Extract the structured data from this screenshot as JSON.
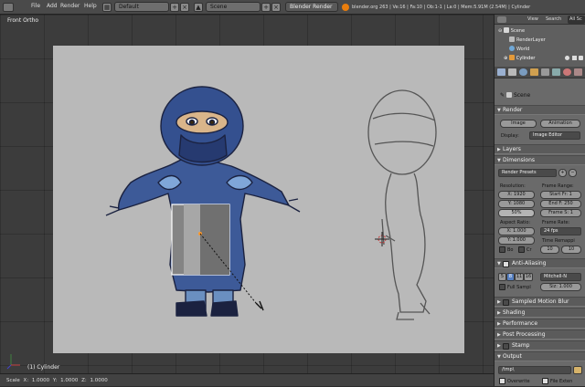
{
  "topbar": {
    "menus": [
      "File",
      "Add",
      "Render",
      "Help"
    ],
    "layout": "Default",
    "scene": "Scene",
    "engine": "Blender Render",
    "info": "blender.org 263 | Ve:16 | Fa:10 | Ob:1-1 | La:0 | Mem:5.91M (2.54M) | Cylinder"
  },
  "viewport": {
    "view_name": "Front Ortho",
    "object_label": "(1) Cylinder"
  },
  "statusbar": {
    "scale": "Scale X: 1.0000  Y: 1.0000  Z: 1.0000"
  },
  "outliner": {
    "view": "View",
    "search": "Search",
    "all": "All Sc",
    "items": [
      "Scene",
      "RenderLayer",
      "World",
      "Cylinder"
    ]
  },
  "props": {
    "context": "Scene",
    "render": {
      "header": "Render",
      "image_btn": "Image",
      "animation_btn": "Animation",
      "display_label": "Display:",
      "display_value": "Image Editor"
    },
    "layers_header": "Layers",
    "dimensions": {
      "header": "Dimensions",
      "presets": "Render Presets",
      "resolution_label": "Resolution:",
      "res_x": "X: 1920",
      "res_y": "Y: 1080",
      "percent": "50%",
      "frame_range_label": "Frame Range:",
      "start": "Start Fr: 1",
      "end": "End F: 250",
      "step": "Frame S: 1",
      "aspect_label": "Aspect Ratio:",
      "aspect_x": "X: 1.000",
      "aspect_y": "Y: 1.000",
      "frame_rate_label": "Frame Rate:",
      "fps": "24 fps",
      "time_remap_label": "Time Remappi",
      "remap_old": "10",
      "remap_new": "10",
      "border": "Bo",
      "crop": "Cr"
    },
    "aa": {
      "header": "Anti-Aliasing",
      "samples": [
        "5",
        "8",
        "11",
        "16"
      ],
      "filter": "Mitchell-N",
      "full_sample": "Full Sampl",
      "size": "Siz: 1.000"
    },
    "panels": [
      "Sampled Motion Blur",
      "Shading",
      "Performance",
      "Post Processing",
      "Stamp",
      "Output"
    ],
    "output": {
      "path": "/tmp\\",
      "overwrite": "Overwrite",
      "file_ext": "File Exten"
    }
  }
}
